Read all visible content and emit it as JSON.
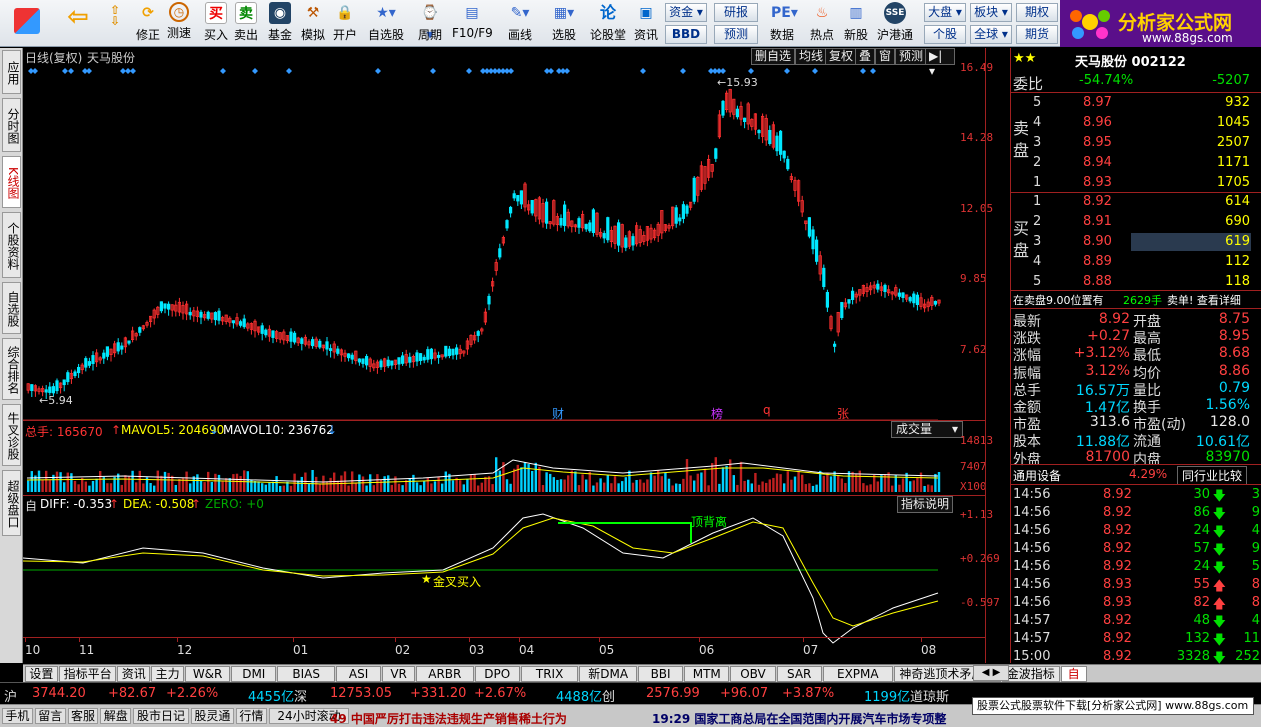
{
  "toolbar": {
    "buttons": [
      "修正",
      "测速",
      "买入",
      "卖出",
      "基金",
      "模拟",
      "开户",
      "自选股",
      "周期",
      "F10/F9",
      "画线",
      "选股",
      "论股堂",
      "资讯",
      "数据",
      "热点",
      "新股",
      "沪港通"
    ],
    "zixun": "资金",
    "bbd": "BBD",
    "yanbao": "研报",
    "yuce": "预测",
    "dapan": "大盘",
    "geban": "个股",
    "bankuai": "板块",
    "quanqiu": "全球",
    "qihuo": "期权",
    "qihuo2": "期货",
    "logo_text": "分析家公式网",
    "logo_url": "www.88gs.com"
  },
  "sidetabs": [
    "应用",
    "分时图",
    "K线图",
    "个股资料",
    "自选股",
    "综合排名",
    "牛叉诊股",
    "超级盘口"
  ],
  "chart_header": {
    "period": "日线(复权)",
    "name": "天马股份",
    "btns": [
      "删自选",
      "均线",
      "复权",
      "叠",
      "窗",
      "预测"
    ]
  },
  "price_axis": [
    "16.49",
    "14.28",
    "12.05",
    "9.85",
    "7.62"
  ],
  "annotations": {
    "high": "15.93",
    "low": "5.94",
    "cai": "财",
    "bang": "榜",
    "q": "q",
    "zhang": "张"
  },
  "volume": {
    "label_total": "总手: 165670",
    "mavol5": "MAVOL5: 204690",
    "mavol10": "MAVOL10: 236762",
    "btn": "成交量",
    "axis": [
      "14813",
      "7407",
      "X100"
    ]
  },
  "macd": {
    "label": "自",
    "diff": "DIFF: -0.353",
    "dea": "DEA: -0.508",
    "zero": "ZERO: +0",
    "btn": "指标说明",
    "axis": [
      "+1.13",
      "+0.269",
      "-0.597"
    ],
    "signal_buy": "金叉买入",
    "signal_div": "顶背离"
  },
  "x_months": [
    "10",
    "11",
    "12",
    "01",
    "02",
    "03",
    "04",
    "05",
    "06",
    "07",
    "08"
  ],
  "quote": {
    "title": "天马股份 002122",
    "weibi_label": "委比",
    "weibi": "-54.74%",
    "weicha": "-5207",
    "sell_label": "卖盘",
    "buy_label": "买盘",
    "sells": [
      {
        "n": "5",
        "p": "8.97",
        "v": "932"
      },
      {
        "n": "4",
        "p": "8.96",
        "v": "1045"
      },
      {
        "n": "3",
        "p": "8.95",
        "v": "2507"
      },
      {
        "n": "2",
        "p": "8.94",
        "v": "1171"
      },
      {
        "n": "1",
        "p": "8.93",
        "v": "1705"
      }
    ],
    "buys": [
      {
        "n": "1",
        "p": "8.92",
        "v": "614"
      },
      {
        "n": "2",
        "p": "8.91",
        "v": "690"
      },
      {
        "n": "3",
        "p": "8.90",
        "v": "619"
      },
      {
        "n": "4",
        "p": "8.89",
        "v": "112"
      },
      {
        "n": "5",
        "p": "8.88",
        "v": "118"
      }
    ],
    "info_line": "在卖盘9.00位置有",
    "info_vol": "2629手",
    "info_tail": "卖单! 查看详细",
    "stats": [
      [
        "最新",
        "8.92",
        "开盘",
        "8.75"
      ],
      [
        "涨跌",
        "+0.27",
        "最高",
        "8.95"
      ],
      [
        "涨幅",
        "+3.12%",
        "最低",
        "8.68"
      ],
      [
        "振幅",
        "3.12%",
        "均价",
        "8.86"
      ],
      [
        "总手",
        "16.57万",
        "量比",
        "0.79"
      ],
      [
        "金额",
        "1.47亿",
        "换手",
        "1.56%"
      ],
      [
        "市盈",
        "313.6",
        "市盈(动)",
        "128.0"
      ],
      [
        "股本",
        "11.88亿",
        "流通",
        "10.61亿"
      ],
      [
        "外盘",
        "81700",
        "内盘",
        "83970"
      ]
    ],
    "industry": "通用设备",
    "industry_pct": "4.29%",
    "industry_btn": "同行业比较",
    "ticks": [
      [
        "14:56",
        "8.92",
        "30",
        "3"
      ],
      [
        "14:56",
        "8.92",
        "86",
        "9"
      ],
      [
        "14:56",
        "8.92",
        "24",
        "4"
      ],
      [
        "14:56",
        "8.92",
        "57",
        "9"
      ],
      [
        "14:56",
        "8.92",
        "24",
        "5"
      ],
      [
        "14:56",
        "8.93",
        "55",
        "8"
      ],
      [
        "14:56",
        "8.93",
        "82",
        "8"
      ],
      [
        "14:57",
        "8.92",
        "48",
        "4"
      ],
      [
        "14:57",
        "8.92",
        "132",
        "11"
      ],
      [
        "15:00",
        "8.92",
        "3328",
        "252"
      ]
    ],
    "tick_dirs": [
      "down",
      "down",
      "down",
      "down",
      "down",
      "up",
      "up",
      "down",
      "down",
      "down"
    ],
    "panel_tabs": [
      "细",
      "分",
      "笔",
      "价",
      "盘",
      "指",
      "财"
    ]
  },
  "bottom_tabs": [
    "设置",
    "指标平台",
    "资讯",
    "主力",
    "W&R",
    "DMI",
    "BIAS",
    "ASI",
    "VR",
    "ARBR",
    "DPO",
    "TRIX",
    "新DMA",
    "BBI",
    "MTM",
    "OBV",
    "SAR",
    "EXPMA",
    "神奇逃顶术矛盾线",
    "金波指标",
    "自"
  ],
  "indices": {
    "sh_label": "沪",
    "sh": "3744.20",
    "sh_chg": "+82.67",
    "sh_pct": "+2.26%",
    "sh_amt": "4455亿",
    "sz_label": "深",
    "sz": "12753.05",
    "sz_chg": "+331.20",
    "sz_pct": "+2.67%",
    "sz_amt": "4488亿",
    "cy_label": "创",
    "cy": "2576.99",
    "cy_chg": "+96.07",
    "cy_pct": "+3.87%",
    "cy_amt": "1199亿",
    "dj_label": "道琼斯"
  },
  "status": {
    "buttons": [
      "手机",
      "留言",
      "客服",
      "解盘",
      "股市日记",
      "股灵通",
      "行情",
      "24小时滚动"
    ],
    "news1": "49 中国严厉打击违法违规生产销售稀土行为",
    "news2": "19:29 国家工商总局在全国范围内开展汽车市场专项整",
    "ad": "股票公式股票软件下载[分析家公式网] www.88gs.com"
  }
}
